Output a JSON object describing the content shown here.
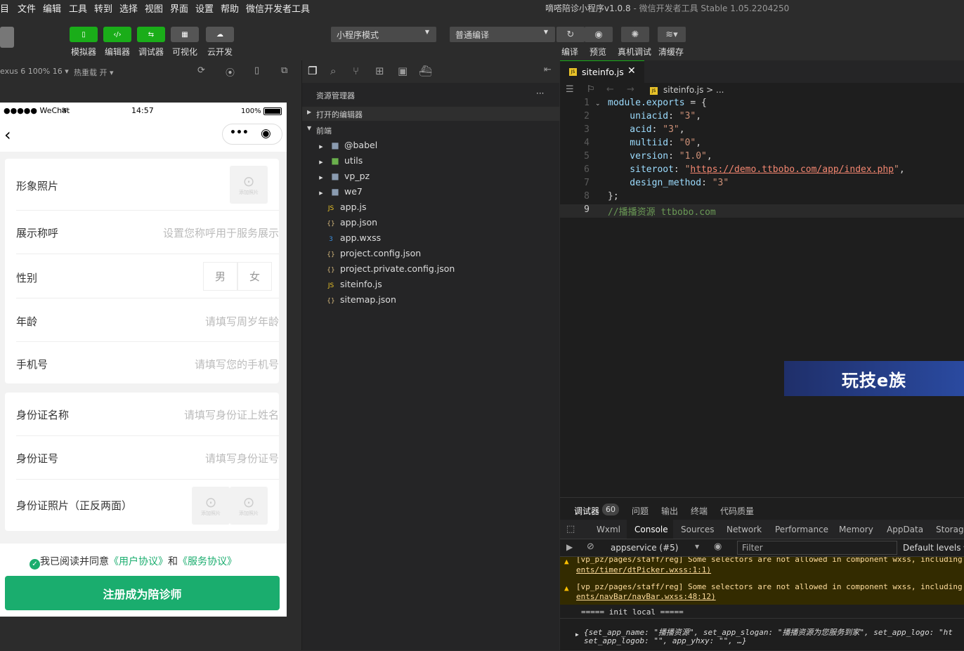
{
  "menubar": {
    "items": [
      "目",
      "文件",
      "编辑",
      "工具",
      "转到",
      "选择",
      "视图",
      "界面",
      "设置",
      "帮助",
      "微信开发者工具"
    ],
    "title": "嘀嗒陪诊小程序v1.0.8",
    "subtitle": " - 微信开发者工具 Stable 1.05.2204250"
  },
  "toolbar": {
    "simulator": "模拟器",
    "editor": "编辑器",
    "debugger": "调试器",
    "visual": "可视化",
    "cloud": "云开发",
    "mode": "小程序模式",
    "compile_mode": "普通编译",
    "compile": "编译",
    "preview": "预览",
    "real_debug": "真机调试",
    "clear_cache": "清缓存"
  },
  "simbar": {
    "device": "exus 6 100% 16 ▾",
    "hot_reload": "热重载 开 ▾"
  },
  "phone": {
    "status": {
      "carrier": "●●●●● WeChat",
      "time": "14:57",
      "battery": "100%"
    },
    "photo_label": "形象照片",
    "add_photo": "添加照片",
    "name_label": "展示称呼",
    "name_placeholder": "设置您称呼用于服务展示",
    "gender_label": "性别",
    "male": "男",
    "female": "女",
    "age_label": "年龄",
    "age_placeholder": "请填写周岁年龄",
    "phone_label": "手机号",
    "phone_placeholder": "请填写您的手机号",
    "id_name_label": "身份证名称",
    "id_name_placeholder": "请填写身份证上姓名",
    "id_no_label": "身份证号",
    "id_no_placeholder": "请填写身份证号",
    "id_photo_label": "身份证照片（正反两面）",
    "agree_prefix": "我已阅读并同意",
    "user_agreement": "《用户协议》",
    "and": "和",
    "service_agreement": "《服务协议》",
    "submit": "注册成为陪诊师"
  },
  "explorer": {
    "title": "资源管理器",
    "more": "···",
    "open_editors": "打开的编辑器",
    "project": "前端",
    "items": [
      {
        "name": "@babel",
        "type": "folder"
      },
      {
        "name": "utils",
        "type": "folder"
      },
      {
        "name": "vp_pz",
        "type": "folder"
      },
      {
        "name": "we7",
        "type": "folder"
      },
      {
        "name": "app.js",
        "type": "js"
      },
      {
        "name": "app.json",
        "type": "json"
      },
      {
        "name": "app.wxss",
        "type": "css"
      },
      {
        "name": "project.config.json",
        "type": "json"
      },
      {
        "name": "project.private.config.json",
        "type": "json"
      },
      {
        "name": "siteinfo.js",
        "type": "js"
      },
      {
        "name": "sitemap.json",
        "type": "json"
      }
    ]
  },
  "editor": {
    "tab": "siteinfo.js",
    "breadcrumb": "siteinfo.js > ...",
    "lines": [
      {
        "n": "1",
        "parts": [
          [
            "k",
            "module.exports"
          ],
          [
            "p",
            " = {"
          ]
        ]
      },
      {
        "n": "2",
        "parts": [
          [
            "k",
            "    uniacid"
          ],
          [
            "p",
            ": "
          ],
          [
            "s",
            "\"3\""
          ],
          [
            "p",
            ","
          ]
        ]
      },
      {
        "n": "3",
        "parts": [
          [
            "k",
            "    acid"
          ],
          [
            "p",
            ": "
          ],
          [
            "s",
            "\"3\""
          ],
          [
            "p",
            ","
          ]
        ]
      },
      {
        "n": "4",
        "parts": [
          [
            "k",
            "    multiid"
          ],
          [
            "p",
            ": "
          ],
          [
            "s",
            "\"0\""
          ],
          [
            "p",
            ","
          ]
        ]
      },
      {
        "n": "5",
        "parts": [
          [
            "k",
            "    version"
          ],
          [
            "p",
            ": "
          ],
          [
            "s",
            "\"1.0\""
          ],
          [
            "p",
            ","
          ]
        ]
      },
      {
        "n": "6",
        "parts": [
          [
            "k",
            "    siteroot"
          ],
          [
            "p",
            ": "
          ],
          [
            "s",
            "\""
          ],
          [
            "u",
            "https://demo.ttbobo.com/app/index.php"
          ],
          [
            "s",
            "\""
          ],
          [
            "p",
            ","
          ]
        ]
      },
      {
        "n": "7",
        "parts": [
          [
            "k",
            "    design_method"
          ],
          [
            "p",
            ": "
          ],
          [
            "s",
            "\"3\""
          ]
        ]
      },
      {
        "n": "8",
        "parts": [
          [
            "p",
            "};"
          ]
        ]
      },
      {
        "n": "9",
        "parts": [
          [
            "c",
            "//播播资源 ttbobo.com"
          ]
        ]
      }
    ]
  },
  "debug": {
    "tabs": [
      "调试器",
      "问题",
      "输出",
      "终端",
      "代码质量"
    ],
    "count": "60",
    "devtabs": [
      "Wxml",
      "Console",
      "Sources",
      "Network",
      "Performance",
      "Memory",
      "AppData",
      "Storage"
    ],
    "context": "appservice (#5)",
    "filter": "Filter",
    "levels": "Default levels ▾",
    "logs": [
      "[vp_pz/pages/staff/reg] Some selectors are not allowed in component wxss, including",
      "ents/timer/dtPicker.wxss:1:1)",
      "[vp_pz/pages/staff/reg] Some selectors are not allowed in component wxss, including",
      "ents/navBar/navBar.wxss:48:12)",
      "===== init local =====",
      "{set_app_name: \"播播资源\", set_app_slogan: \"播播资源为您服务到家\", set_app_logo: \"ht",
      "set_app_logob: \"\", app_yhxy: \"\", …}"
    ]
  },
  "banner": "玩技e族"
}
